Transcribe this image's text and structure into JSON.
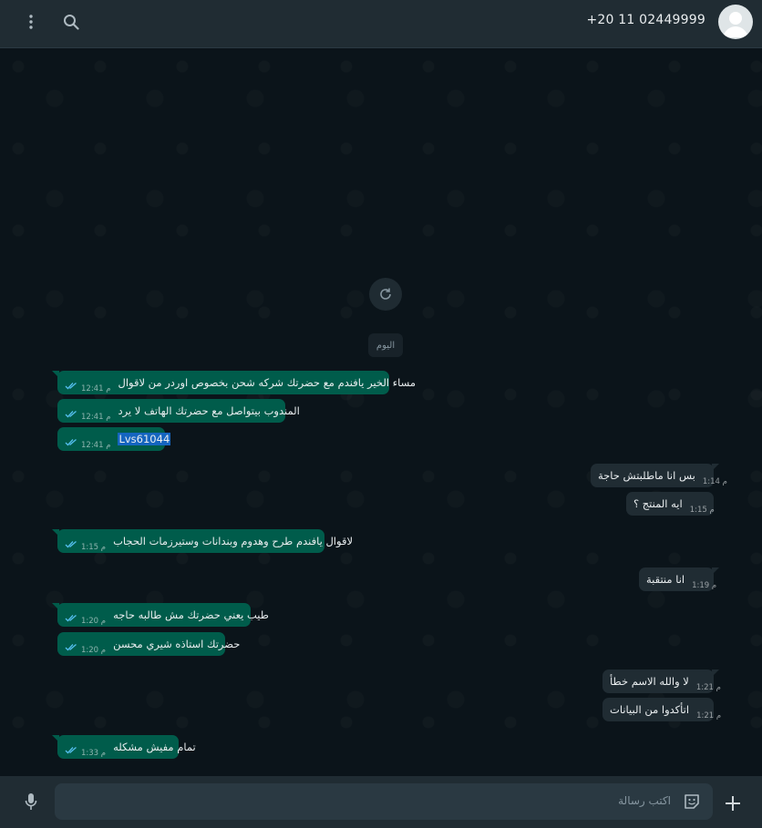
{
  "header": {
    "contact_phone": "+20 11 02449999"
  },
  "chat": {
    "date_divider": "اليوم",
    "messages": [
      {
        "direction": "out",
        "text": "مساء الخير يافندم مع حضرتك شركه شحن بخصوص اوردر من لاقوال",
        "time": "12:41 م",
        "status": "read"
      },
      {
        "direction": "out",
        "text": "المندوب بيتواصل مع حضرتك الهاتف لا يرد",
        "time": "12:41 م",
        "status": "read"
      },
      {
        "direction": "out",
        "text": "Lvs61044",
        "time": "12:41 م",
        "status": "read",
        "selected": true
      },
      {
        "direction": "in",
        "text": "بس انا ماطلبتش حاجة",
        "time": "1:14 م"
      },
      {
        "direction": "in",
        "text": "ايه المنتج ؟",
        "time": "1:15 م"
      },
      {
        "direction": "out",
        "text": "لاقوال يافندم طرح وهدوم وبندانات وستيرزمات الحجاب",
        "time": "1:15 م",
        "status": "read"
      },
      {
        "direction": "in",
        "text": "انا منتقبة",
        "time": "1:19 م"
      },
      {
        "direction": "out",
        "text": "طيب يعني حضرتك مش طالبه حاجه",
        "time": "1:20 م",
        "status": "read"
      },
      {
        "direction": "out",
        "text": "حضرتك استاذه شيري محسن",
        "time": "1:20 م",
        "status": "read"
      },
      {
        "direction": "in",
        "text": "لا والله الاسم خطأ",
        "time": "1:21 م"
      },
      {
        "direction": "in",
        "text": "اتأكدوا من البيانات",
        "time": "1:21 م"
      },
      {
        "direction": "out",
        "text": "تمام مفيش مشكله",
        "time": "1:33 م",
        "status": "read"
      }
    ]
  },
  "composer": {
    "placeholder": "اكتب رسالة"
  },
  "colors": {
    "background": "#0b141a",
    "header": "#202c33",
    "outgoing_bubble": "#005c4b",
    "incoming_bubble": "#202c33",
    "read_ticks": "#53bdeb"
  },
  "icons": {
    "menu": "kebab-menu-icon",
    "search": "search-icon",
    "avatar": "default-avatar-icon",
    "refresh": "refresh-icon",
    "mic": "mic-icon",
    "sticker": "sticker-icon",
    "attach": "plus-icon"
  }
}
